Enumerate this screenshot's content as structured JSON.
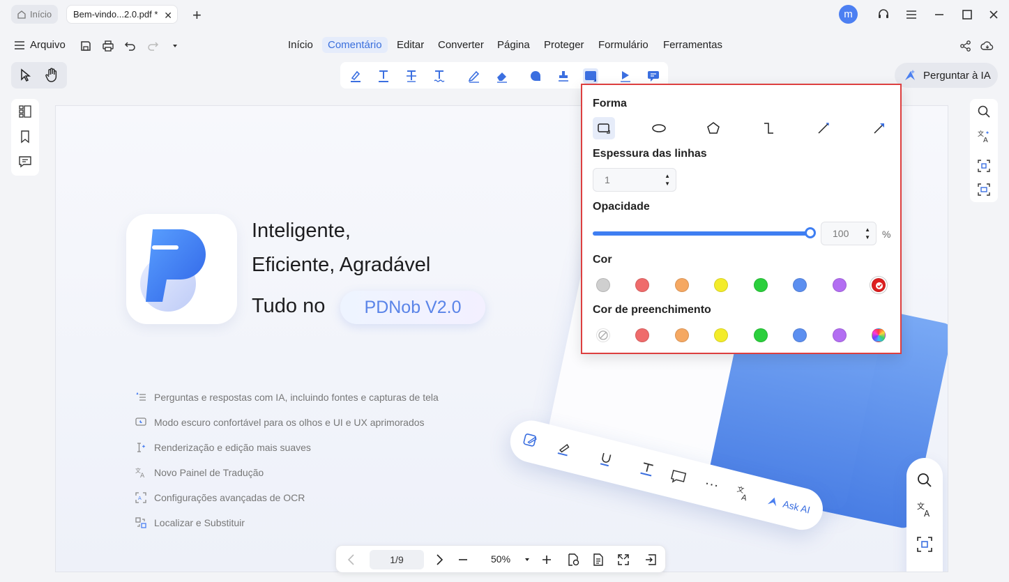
{
  "tabs": {
    "home": "Início",
    "document": "Bem-vindo...2.0.pdf *"
  },
  "user": {
    "avatar_letter": "m"
  },
  "menubar": {
    "file": "Arquivo",
    "items": [
      "Início",
      "Comentário",
      "Editar",
      "Converter",
      "Página",
      "Proteger",
      "Formulário",
      "Ferramentas"
    ],
    "active": "Comentário"
  },
  "ask_ai": "Perguntar à IA",
  "document": {
    "hero_line1": "Inteligente,",
    "hero_line2": "Eficiente,  Agradável",
    "hero_line3": "Tudo no",
    "badge": "PDNob V2.0",
    "features": [
      "Perguntas e respostas com IA, incluindo fontes e capturas de tela",
      "Modo escuro confortável para os olhos e UI e UX aprimorados",
      "Renderização e edição mais suaves",
      "Novo Painel de Tradução",
      "Configurações avançadas de OCR",
      "Localizar e Substituir"
    ],
    "mock_ask_ai": "Ask AI"
  },
  "bottom": {
    "page": "1/9",
    "zoom": "50%"
  },
  "popup": {
    "shape_title": "Forma",
    "shapes": [
      "rectangle-icon",
      "ellipse-icon",
      "polygon-icon",
      "polyline-icon",
      "line-icon",
      "arrow-icon"
    ],
    "line_width_title": "Espessura das linhas",
    "line_width": "1",
    "opacity_title": "Opacidade",
    "opacity": "100",
    "opacity_value": 1.0,
    "opacity_unit": "%",
    "color_title": "Cor",
    "colors": [
      "#cfcfcf",
      "#ef6b6b",
      "#f5a862",
      "#f3ec2a",
      "#2bcf3c",
      "#5c8ff0",
      "#b36ef2",
      "#dd1f1f"
    ],
    "selected_color": "#dd1f1f",
    "fill_title": "Cor de preenchimento",
    "fill_colors": [
      "none",
      "#ef6b6b",
      "#f5a862",
      "#f3ec2a",
      "#2bcf3c",
      "#5c8ff0",
      "#b36ef2",
      "rainbow"
    ]
  },
  "colors": {
    "accent": "#3e7ef2",
    "popup_border": "#dd3f3f"
  }
}
